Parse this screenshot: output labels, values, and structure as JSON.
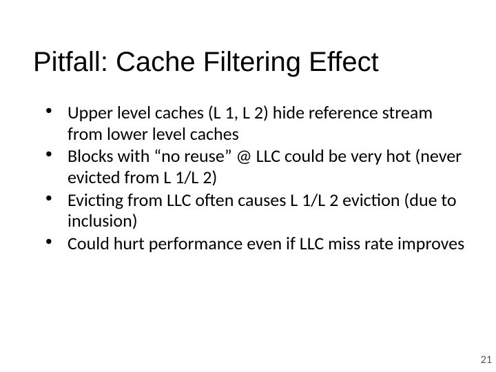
{
  "slide": {
    "title": "Pitfall: Cache Filtering Effect",
    "bullets": [
      "Upper level caches (L 1, L 2) hide reference stream from lower level caches",
      "Blocks with “no reuse”  @ LLC could be very hot (never evicted from L 1/L 2)",
      "Evicting from LLC often causes L 1/L 2 eviction (due to inclusion)",
      "Could hurt performance even if LLC miss rate improves"
    ],
    "page_number": "21"
  }
}
